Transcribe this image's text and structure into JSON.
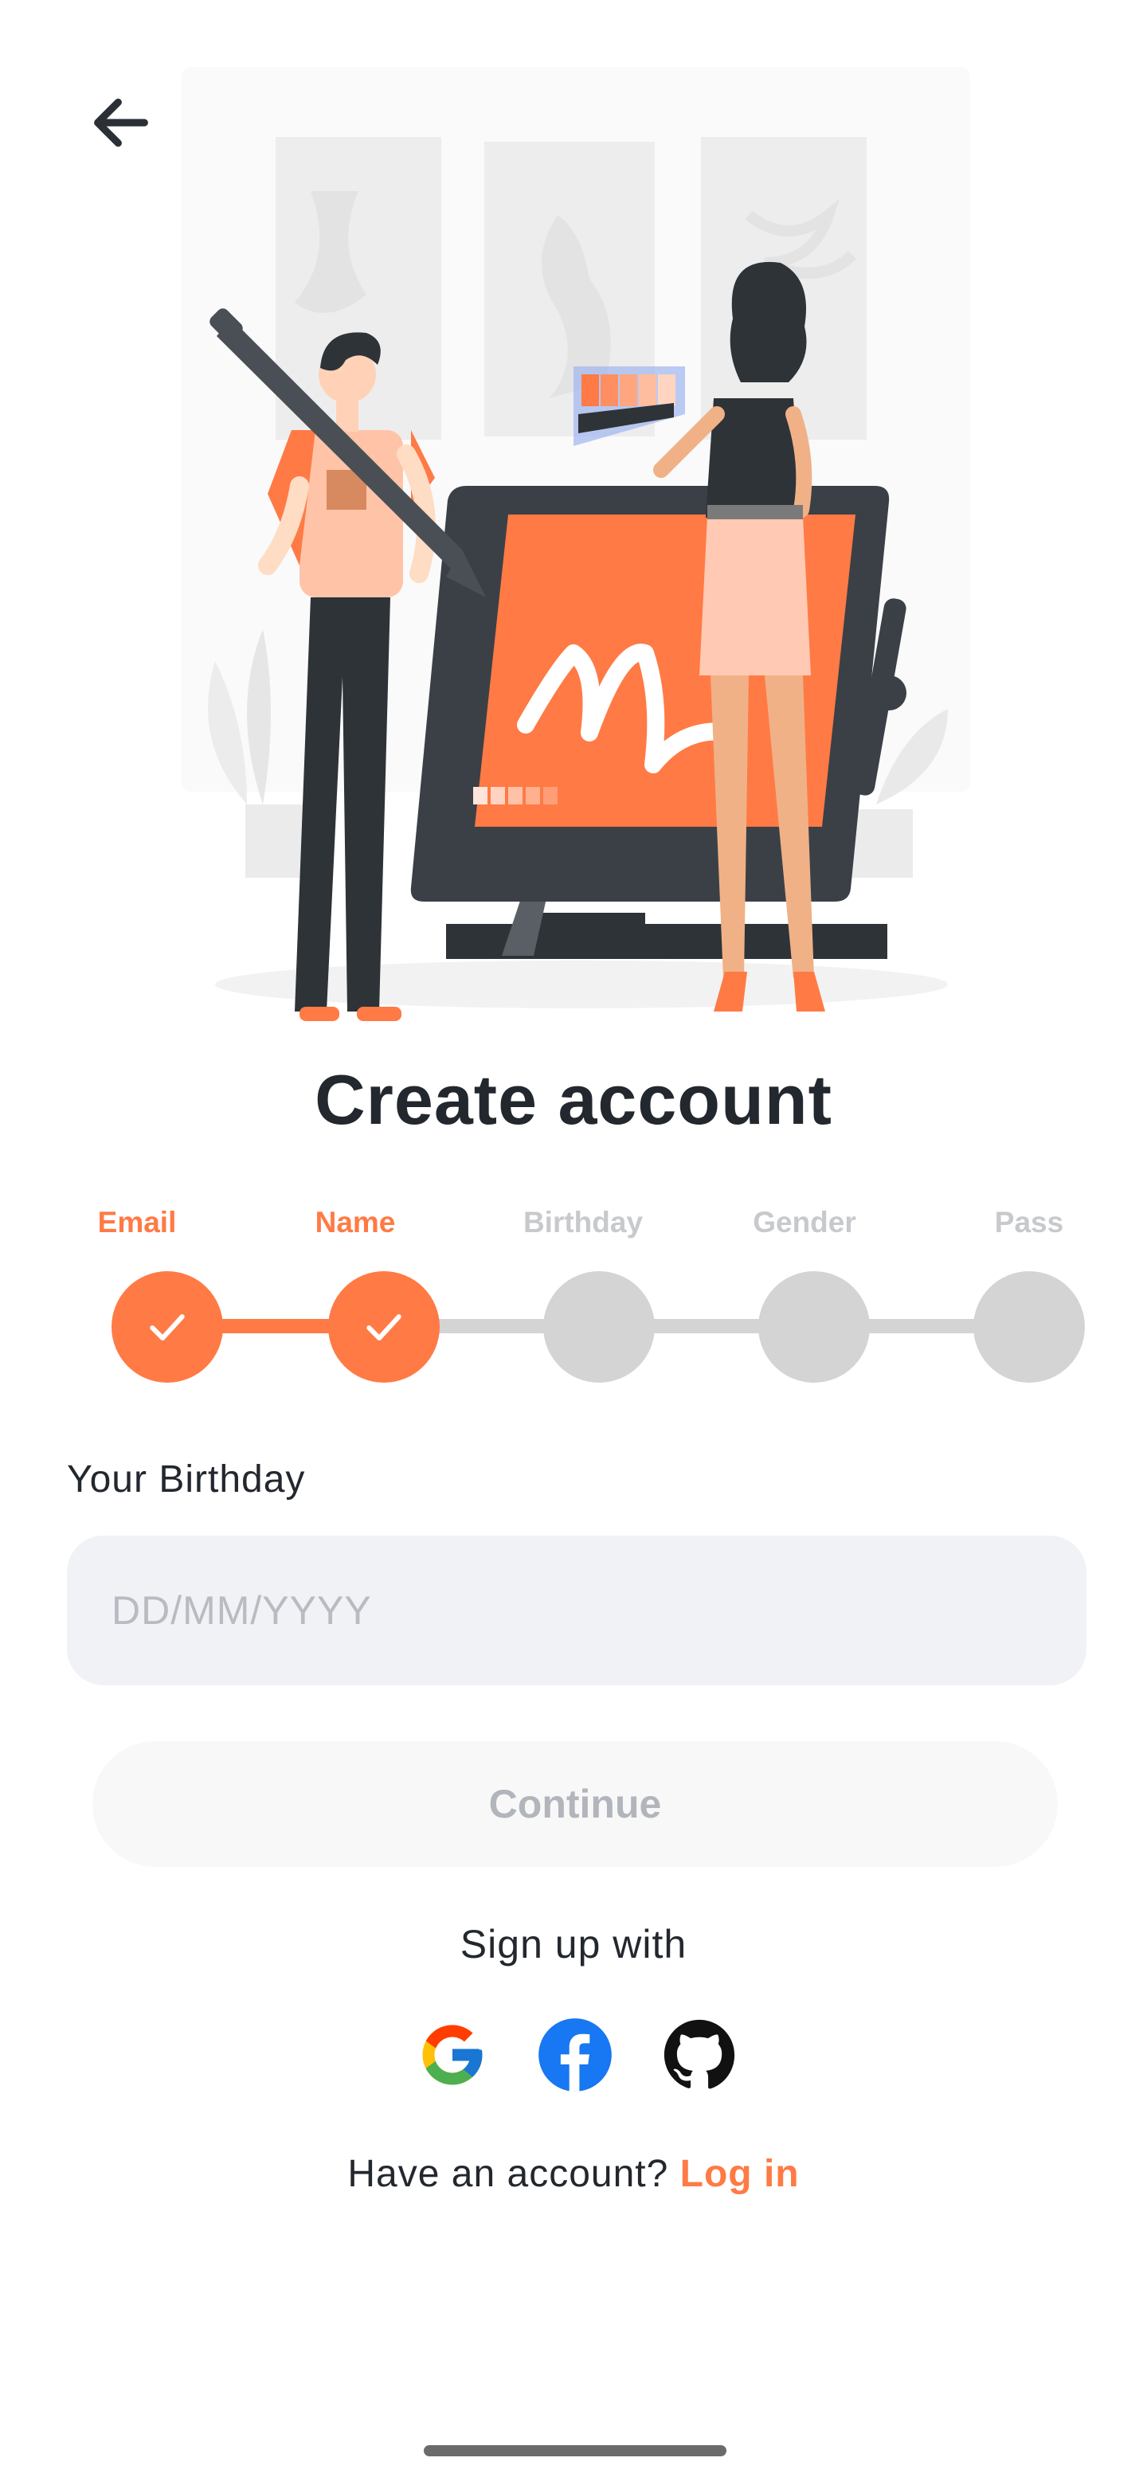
{
  "header": {
    "back_icon": "arrow-left-icon"
  },
  "hero": {
    "illustration": "designers-drawing-tablet-illustration",
    "colors": {
      "accent": "#ff7a45",
      "dark": "#2e3338",
      "skin": "#f0b187",
      "light": "#f3f3f3"
    }
  },
  "title": "Create account",
  "stepper": {
    "steps": [
      {
        "label": "Email",
        "status": "done"
      },
      {
        "label": "Name",
        "status": "done"
      },
      {
        "label": "Birthday",
        "status": "pending"
      },
      {
        "label": "Gender",
        "status": "pending"
      },
      {
        "label": "Pass",
        "status": "pending"
      }
    ],
    "completed": 2,
    "check_icon": "check-icon"
  },
  "birthday_field": {
    "label": "Your Birthday",
    "placeholder": "DD/MM/YYYY",
    "value": ""
  },
  "continue_button": {
    "label": "Continue",
    "disabled": true
  },
  "social": {
    "heading": "Sign up with",
    "providers": [
      {
        "name": "Google",
        "icon": "google-icon"
      },
      {
        "name": "Facebook",
        "icon": "facebook-icon"
      },
      {
        "name": "GitHub",
        "icon": "github-icon"
      }
    ]
  },
  "footer": {
    "prompt": "Have an account?",
    "login_label": "Log in"
  },
  "colors": {
    "accent": "#ff7a45",
    "text": "#23272e",
    "muted": "#c7c9cc",
    "inactive_step": "#d4d4d4",
    "field_bg": "#f1f2f6",
    "button_bg": "#f8f8f9"
  }
}
